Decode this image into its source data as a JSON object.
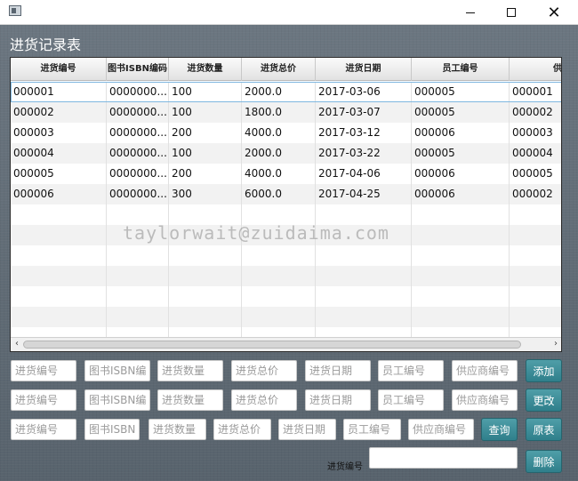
{
  "window": {
    "close_glyph": "✕"
  },
  "page_title": "进货记录表",
  "table": {
    "columns": [
      "进货编号",
      "图书ISBN编码",
      "进货数量",
      "进货总价",
      "进货日期",
      "员工编号",
      "供应商编"
    ],
    "rows": [
      [
        "000001",
        "0000000...",
        "100",
        "2000.0",
        "2017-03-06",
        "000005",
        "000001"
      ],
      [
        "000002",
        "0000000...",
        "100",
        "1800.0",
        "2017-03-07",
        "000005",
        "000002"
      ],
      [
        "000003",
        "0000000...",
        "200",
        "4000.0",
        "2017-03-12",
        "000006",
        "000003"
      ],
      [
        "000004",
        "0000000...",
        "100",
        "2000.0",
        "2017-03-22",
        "000005",
        "000004"
      ],
      [
        "000005",
        "0000000...",
        "200",
        "4000.0",
        "2017-04-06",
        "000006",
        "000005"
      ],
      [
        "000006",
        "0000000...",
        "300",
        "6000.0",
        "2017-04-25",
        "000006",
        "000002"
      ]
    ],
    "watermark": "taylorwait@zuidaima.com"
  },
  "form": {
    "add_row": {
      "placeholders": [
        "进货编号",
        "图书ISBN编",
        "进货数量",
        "进货总价",
        "进货日期",
        "员工编号",
        "供应商编号"
      ],
      "button": "添加"
    },
    "update_row": {
      "placeholders": [
        "进货编号",
        "图书ISBN编",
        "进货数量",
        "进货总价",
        "进货日期",
        "员工编号",
        "供应商编号"
      ],
      "button": "更改"
    },
    "query_row": {
      "placeholders": [
        "进货编号",
        "图书ISBN",
        "进货数量",
        "进货总价",
        "进货日期",
        "员工编号",
        "供应商编号"
      ],
      "query_button": "查询",
      "original_button": "原表"
    },
    "delete_row": {
      "label": "进货编号",
      "value": "",
      "button": "删除"
    }
  },
  "colors": {
    "accent_button": "#2f7f8b",
    "background": "#5e6a74"
  }
}
